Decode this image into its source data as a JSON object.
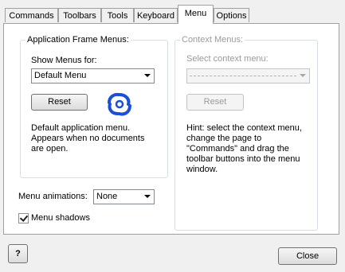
{
  "tabs": [
    {
      "label": "Commands"
    },
    {
      "label": "Toolbars"
    },
    {
      "label": "Tools"
    },
    {
      "label": "Keyboard"
    },
    {
      "label": "Menu"
    },
    {
      "label": "Options"
    }
  ],
  "active_tab": "Menu",
  "app_frame": {
    "title": "Application Frame Menus:",
    "show_menus_label": "Show Menus for:",
    "show_menus_value": "Default Menu",
    "reset_label": "Reset",
    "description": "Default application menu.\nAppears when no documents\nare open."
  },
  "context_menus": {
    "title": "Context Menus:",
    "select_label": "Select context menu:",
    "select_value": "",
    "reset_label": "Reset",
    "hint": "Hint: select the context menu,\nchange the page to\n\"Commands\" and drag the\ntoolbar buttons into the menu\nwindow."
  },
  "menu_animations": {
    "label": "Menu animations:",
    "value": "None"
  },
  "menu_shadows": {
    "label": "Menu shadows",
    "checked": true
  },
  "footer": {
    "help_icon_glyph": "?",
    "close_label": "Close"
  },
  "colors": {
    "accent_blue": "#1a4fd6",
    "group_border": "#d5dfe5",
    "disabled_text": "#9a9a9a"
  }
}
